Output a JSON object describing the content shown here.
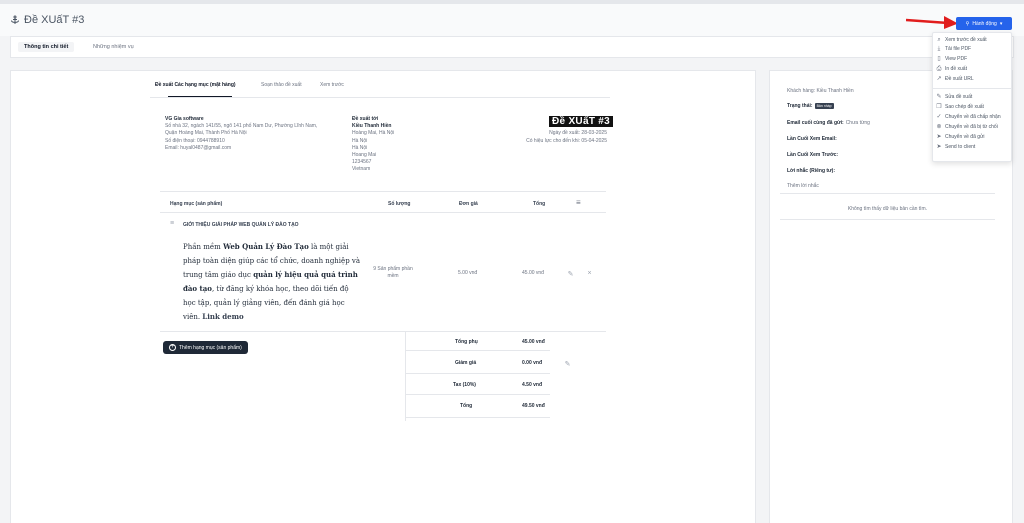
{
  "page": {
    "title": "Đề XUấT #3"
  },
  "tabs": {
    "details": "Thông tin chi tiết",
    "tasks": "Những nhiệm vụ"
  },
  "subtabs": {
    "items": "Đề xuất Các hạng mục (mặt hàng)",
    "draft": "Soạn thảo đề xuất",
    "view": "Xem trước"
  },
  "seller": {
    "name": "VG Gia software",
    "address_1": "Số nhà 32, ngách 141/55, ngõ 141 phố Nam Dư, Phường Lĩnh Nam,",
    "address_2": "Quận Hoàng Mai, Thành Phố Hà Nội",
    "phone": "Số điện thoại: 0944788910",
    "email": "Email: huyal0487@gmail.com"
  },
  "recipient": {
    "heading": "Đề xuất tới",
    "name": "Kiều Thanh Hiền",
    "line_1": "Hoàng Mai, Hà Nội",
    "line_2": "Hà Nội",
    "line_3": "Hà Nội",
    "line_4": "Hoang Mai",
    "line_5": "1234567",
    "line_6": "Vietnam"
  },
  "proposal": {
    "badge": "Đề XUấT #3",
    "date": "Ngày đề xuất: 28-03-2025",
    "valid_until": "Có hiệu lực cho đến khi: 05-04-2025"
  },
  "table": {
    "headers": {
      "item": "Hạng mục (sản phẩm)",
      "qty": "Số lượng",
      "price": "Đơn giá",
      "total": "Tổng"
    },
    "row": {
      "title": "GIỚI THIỆU GIẢI PHÁP WEB QUẢN LÝ ĐÀO TẠO",
      "desc_a": "Phần mềm ",
      "desc_b": "Web Quản Lý Đào Tạo",
      "desc_c": " là một giải pháp toàn diện giúp các tổ chức, doanh nghiệp và trung tâm giáo dục ",
      "desc_d": "quản lý hiệu quả quá trình đào tạo",
      "desc_e": ", từ đăng ký khóa học, theo dõi tiến độ học tập, quản lý giảng viên, đến đánh giá học viên. ",
      "desc_link": "Link demo",
      "qty_1": "9 Sản phẩm phần",
      "qty_2": "mềm",
      "price": "5.00 vnđ",
      "total": "45.00 vnđ"
    },
    "add_button": "Thêm hạng mục (sản phẩm)"
  },
  "totals": {
    "subtotal_label": "Tổng phụ",
    "subtotal": "45.00 vnđ",
    "discount_label": "Giảm giá",
    "discount": "0.00 vnđ",
    "tax_label": "Tax (10%)",
    "tax": "4.50 vnđ",
    "total_label": "Tổng",
    "total": "49.50 vnđ"
  },
  "sidebar": {
    "customer": "Khách hàng: Kiều Thanh Hiền",
    "status_label": "Trạng thái:",
    "status_badge": "Bản nháp",
    "last_email_label": "Email cuối cùng đã gửi:",
    "last_email_value": "Chưa từng",
    "last_view_email": "Lần Cuối Xem Email:",
    "last_view_prev": "Lần Cuối Xem Trước:",
    "reminder": "Lời nhắc (Riêng tư):",
    "add_reminder": "Thêm lời nhắc",
    "no_data": "Không tìm thấy dữ liệu bản cần tìm."
  },
  "actions": {
    "button": "Hành động",
    "items": [
      "Xem trước đề xuất",
      "Tải file PDF",
      "View PDF",
      "In đề xuất",
      "Đề xuất URL",
      "Sửa đề xuất",
      "Sao chép đề xuất",
      "Chuyển về đã chấp nhận",
      "Chuyển về đã bị từ chối",
      "Chuyển về đã gửi",
      "Send to client"
    ]
  },
  "colors": {
    "primary": "#2563eb",
    "arrow": "#e11d1d",
    "dark_button": "#1f2937"
  }
}
